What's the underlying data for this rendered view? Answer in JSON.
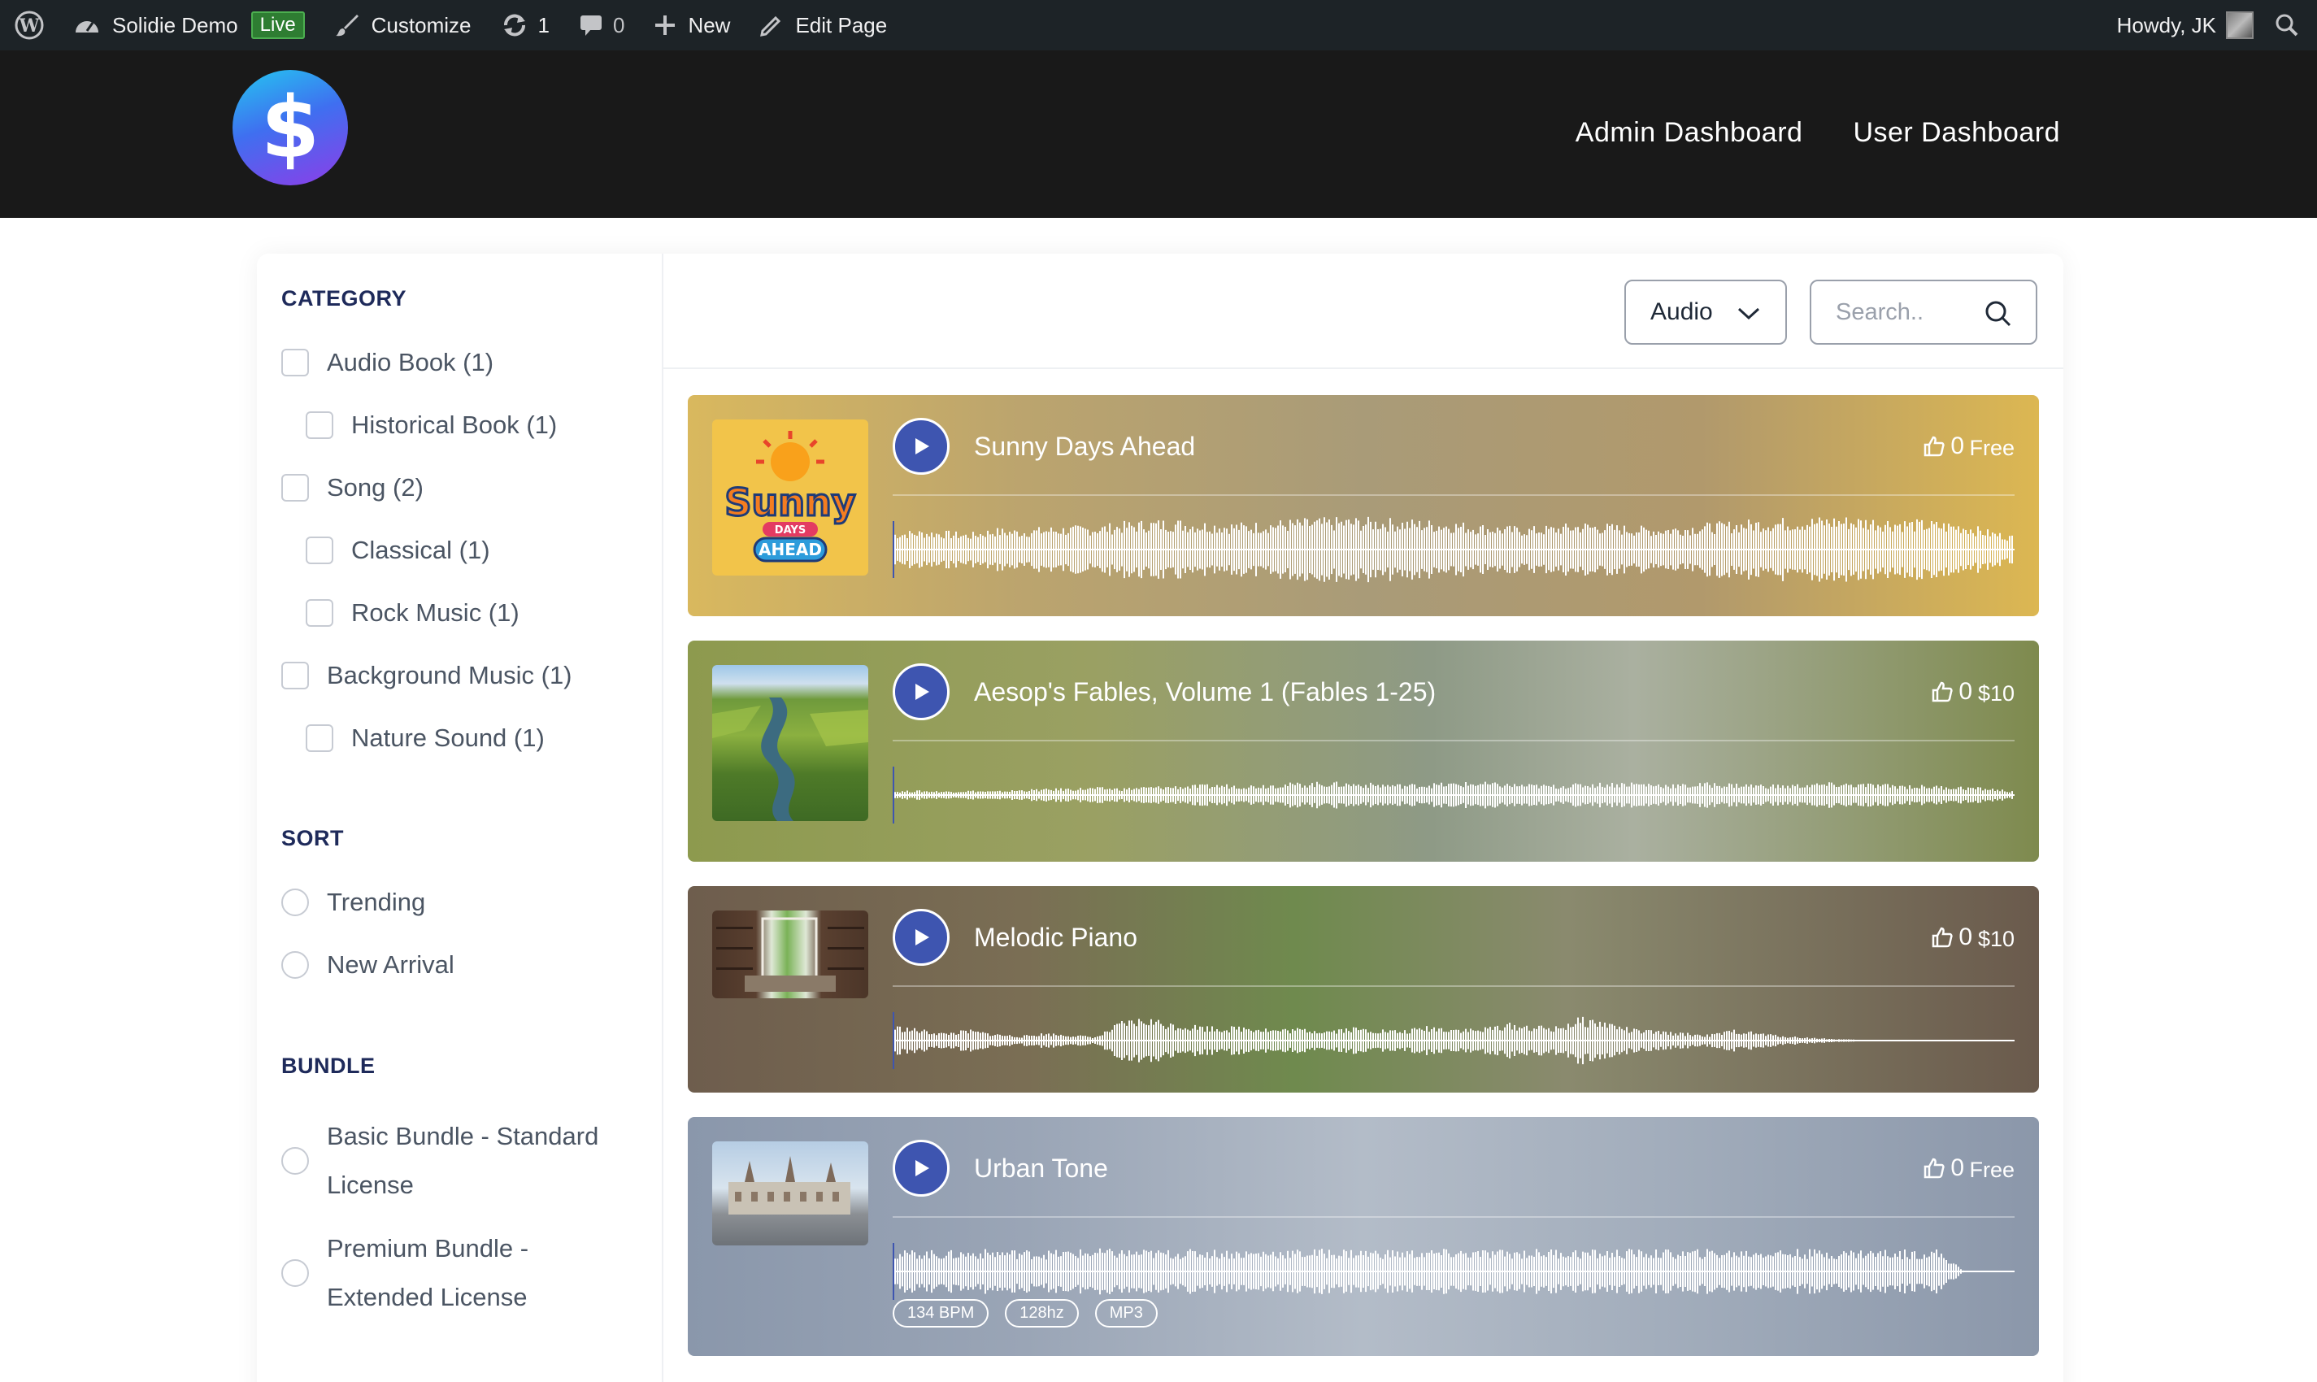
{
  "admin_bar": {
    "site_name": "Solidie Demo",
    "live_badge": "Live",
    "customize": "Customize",
    "updates_count": "1",
    "comments_count": "0",
    "new": "New",
    "edit_page": "Edit Page",
    "howdy": "Howdy, JK"
  },
  "header": {
    "logo_symbol": "$",
    "nav": [
      "Admin Dashboard",
      "User Dashboard"
    ]
  },
  "sidebar": {
    "category_title": "CATEGORY",
    "categories": [
      {
        "label": "Audio Book (1)",
        "level": 0
      },
      {
        "label": "Historical Book (1)",
        "level": 1
      },
      {
        "label": "Song (2)",
        "level": 0
      },
      {
        "label": "Classical (1)",
        "level": 1
      },
      {
        "label": "Rock Music (1)",
        "level": 1
      },
      {
        "label": "Background Music (1)",
        "level": 0
      },
      {
        "label": "Nature Sound (1)",
        "level": 1
      }
    ],
    "sort_title": "SORT",
    "sort_options": [
      "Trending",
      "New Arrival"
    ],
    "bundle_title": "BUNDLE",
    "bundles": [
      {
        "line1": "Basic Bundle - Standard",
        "line2": "License"
      },
      {
        "line1": "Premium Bundle -",
        "line2": "Extended License"
      }
    ]
  },
  "toolbar": {
    "type_value": "Audio",
    "search_placeholder": "Search.."
  },
  "tracks": [
    {
      "title": "Sunny Days Ahead",
      "likes": "0",
      "price": "Free",
      "thumb_text_1": "Sunny",
      "thumb_text_2": "DAYS",
      "thumb_text_3": "AHEAD"
    },
    {
      "title": "Aesop's Fables, Volume 1 (Fables 1-25)",
      "likes": "0",
      "price": "$10"
    },
    {
      "title": "Melodic Piano",
      "likes": "0",
      "price": "$10"
    },
    {
      "title": "Urban Tone",
      "likes": "0",
      "price": "Free",
      "tags": [
        "134 BPM",
        "128hz",
        "MP3"
      ]
    }
  ],
  "colors": {
    "play_button": "#3e55b0",
    "header_bg": "#191919",
    "admin_bar_bg": "#1d2327",
    "heading": "#1e2a5a"
  }
}
